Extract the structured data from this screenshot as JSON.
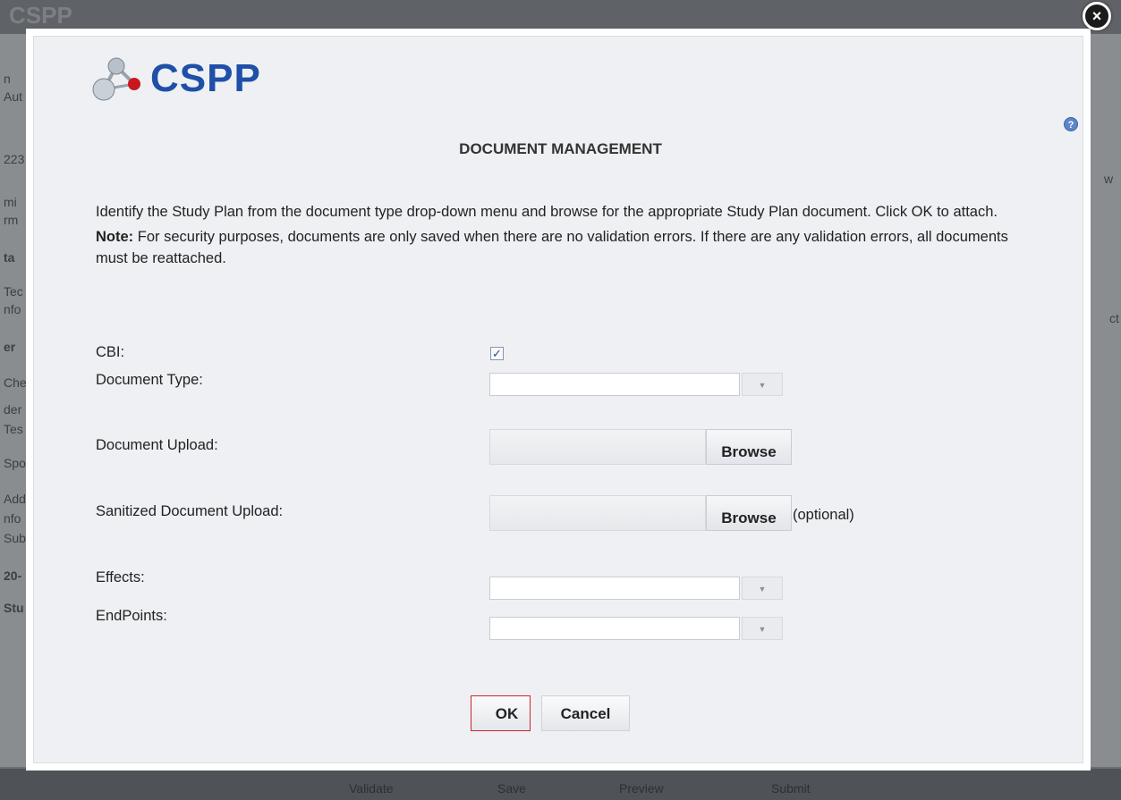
{
  "background": {
    "top_logo": "CSPP",
    "left_fragments": [
      "n",
      "Aut",
      "223",
      "mi",
      "rm",
      "ta",
      "Tec",
      "nfo",
      "er",
      "Che",
      "der",
      "Tes",
      "Spo",
      "Add",
      "nfo",
      "Sub",
      "20-",
      "Stu"
    ],
    "right_fragments": [
      "w",
      "ct"
    ],
    "bottom_fragments": [
      "Validate",
      "Save",
      "Preview",
      "Submit"
    ]
  },
  "modal": {
    "close_symbol": "×",
    "logo_text": "CSPP",
    "help_symbol": "?",
    "title": "DOCUMENT MANAGEMENT",
    "instructions": "Identify the Study Plan from the document type drop-down menu and browse for the appropriate Study Plan document. Click OK to attach.",
    "note_label": "Note:",
    "note_text": " For security purposes, documents are only saved when there are no validation errors. If there are any validation errors, all documents must be reattached.",
    "fields": {
      "cbi_label": "CBI:",
      "cbi_checked_symbol": "✓",
      "document_type_label": "Document Type:",
      "document_type_value": "",
      "document_upload_label": "Document Upload:",
      "sanitized_upload_label": "Sanitized Document Upload:",
      "browse_label": "Browse",
      "optional_label": "(optional)",
      "effects_label": "Effects:",
      "effects_value": "",
      "endpoints_label": "EndPoints:",
      "endpoints_value": "",
      "dropdown_arrow": "▼"
    },
    "buttons": {
      "ok": "OK",
      "cancel": "Cancel"
    }
  },
  "colors": {
    "logo_blue": "#1f4fa8",
    "dialog_bg": "#eef0f3",
    "ok_focus_border": "#d0232e"
  }
}
